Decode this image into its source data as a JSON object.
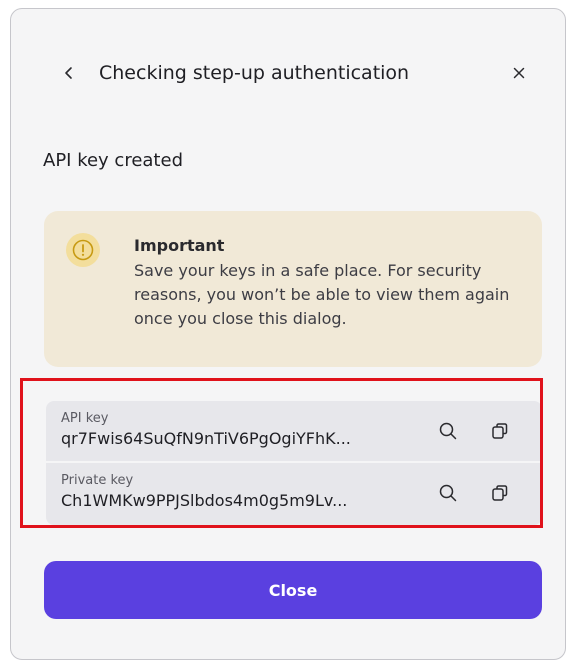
{
  "dialog": {
    "title": "Checking step-up authentication",
    "back_icon": "chevron-left-icon",
    "close_icon": "close-icon"
  },
  "section_title": "API key created",
  "notice": {
    "icon": "warning-circle-icon",
    "heading": "Important",
    "text": "Save your keys in a safe place. For security reasons, you won’t be able to view them again once you close this dialog.",
    "background_color": "#f1e9d7",
    "icon_color": "#f3de9c"
  },
  "keys": [
    {
      "label": "API key",
      "value": "qr7Fwis64SuQfN9nTiV6PgOgiYFhK...",
      "view_icon": "search-icon",
      "copy_icon": "copy-icon"
    },
    {
      "label": "Private key",
      "value": "Ch1WMKw9PPJSlbdos4m0g5m9Lv...",
      "view_icon": "search-icon",
      "copy_icon": "copy-icon"
    }
  ],
  "close_button": {
    "label": "Close",
    "color": "#5a40e0"
  },
  "highlight_color": "#e0121b"
}
